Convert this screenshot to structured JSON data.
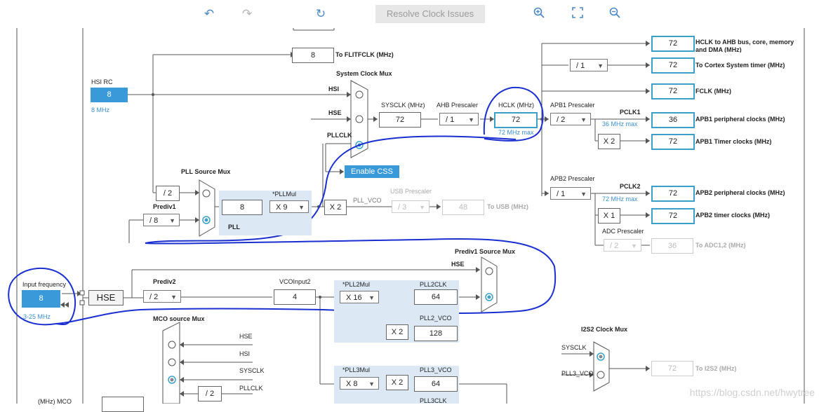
{
  "toolbar": {
    "undo_icon": "undo-icon",
    "redo_icon": "redo-icon",
    "refresh_icon": "refresh-icon",
    "resolve_label": "Resolve Clock Issues",
    "zoom_in_icon": "zoom-in-icon",
    "fit_icon": "fit-screen-icon",
    "zoom_out_icon": "zoom-out-icon"
  },
  "colors": {
    "accent": "#3a9ad9",
    "output_border": "#3aa0c8",
    "region": "#dce9f5",
    "annotation": "#1a2fd0"
  },
  "hsi": {
    "title": "HSI RC",
    "value": "8",
    "freq": "8 MHz"
  },
  "flitf": {
    "value": "8",
    "label": "To FLITFCLK (MHz)"
  },
  "sys_mux": {
    "title": "System Clock Mux",
    "hsi": "HSI",
    "hse": "HSE",
    "pllclk": "PLLCLK"
  },
  "sysclk": {
    "title": "SYSCLK (MHz)",
    "value": "72"
  },
  "ahb": {
    "title": "AHB Prescaler",
    "value": "/ 1"
  },
  "hclk": {
    "title": "HCLK (MHz)",
    "value": "72",
    "max": "72 MHz max"
  },
  "enable_css": "Enable CSS",
  "apb1": {
    "title": "APB1 Prescaler",
    "value": "/ 2",
    "pclk": "PCLK1",
    "max": "36 MHz max",
    "timer_mult": "X 2"
  },
  "apb2": {
    "title": "APB2 Prescaler",
    "value": "/ 1",
    "pclk": "PCLK2",
    "max": "72 MHz max",
    "timer_mult": "X 1"
  },
  "cortex_div": "/ 1",
  "adc": {
    "title": "ADC Prescaler",
    "value": "/ 2",
    "out": "36",
    "label": "To ADC1,2 (MHz)"
  },
  "outputs": {
    "hclk_ahb": {
      "value": "72",
      "label": "HCLK to AHB bus, core, memory and DMA (MHz)"
    },
    "cortex": {
      "value": "72",
      "label": "To Cortex System timer (MHz)"
    },
    "fclk": {
      "value": "72",
      "label": "FCLK (MHz)"
    },
    "apb1_periph": {
      "value": "36",
      "label": "APB1 peripheral clocks (MHz)"
    },
    "apb1_timer": {
      "value": "72",
      "label": "APB1 Timer clocks (MHz)"
    },
    "apb2_periph": {
      "value": "72",
      "label": "APB2 peripheral clocks (MHz)"
    },
    "apb2_timer": {
      "value": "72",
      "label": "APB2 timer clocks (MHz)"
    }
  },
  "pll_src": {
    "title": "PLL Source Mux",
    "hsi_div": "/ 2",
    "prediv1_title": "Prediv1",
    "prediv1_value": "/ 8"
  },
  "pll": {
    "title": "PLL",
    "mul_title": "*PLLMul",
    "in_value": "8",
    "mul_value": "X 9"
  },
  "usb": {
    "mult": "X 2",
    "vco_label": "PLL_VCO",
    "title": "USB Prescaler",
    "div": "/ 3",
    "value": "48",
    "label": "To USB (MHz)"
  },
  "prediv1_mux": {
    "title": "Prediv1 Source Mux",
    "hse": "HSE"
  },
  "input": {
    "title": "Input frequency",
    "value": "8",
    "range": "3-25 MHz",
    "hse": "HSE"
  },
  "prediv2": {
    "title": "Prediv2",
    "value": "/ 2"
  },
  "vcoinput2": {
    "title": "VCOInput2",
    "value": "4"
  },
  "pll2": {
    "mul_title": "*PLL2Mul",
    "mul_value": "X 16",
    "clk_title": "PLL2CLK",
    "clk_value": "64",
    "vco_title": "PLL2_VCO",
    "vco_mult": "X 2",
    "vco_value": "128"
  },
  "pll3": {
    "mul_title": "*PLL3Mul",
    "mul_value": "X 8",
    "vco_title": "PLL3_VCO",
    "vco_mult": "X 2",
    "vco_value": "64",
    "clk_title": "PLL3CLK"
  },
  "mco": {
    "title": "MCO source Mux",
    "hse": "HSE",
    "hsi": "HSI",
    "sysclk": "SYSCLK",
    "pllclk": "PLLCLK",
    "div": "/ 2",
    "out_label": "(MHz) MCO"
  },
  "i2s2": {
    "title": "I2S2 Clock Mux",
    "sysclk": "SYSCLK",
    "pll3vco": "PLL3_VCO",
    "value": "72",
    "label": "To I2S2 (MHz)"
  },
  "watermark": "https://blog.csdn.net/hwytree"
}
